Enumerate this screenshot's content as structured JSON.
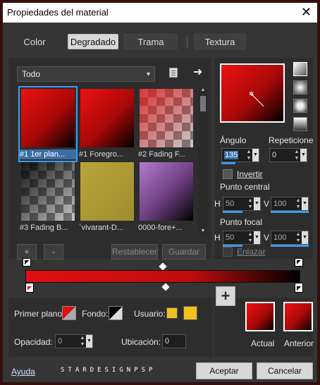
{
  "window": {
    "title": "Propiedades del material",
    "close": "✕"
  },
  "tabs": [
    {
      "label": "Color"
    },
    {
      "label": "Degradado"
    },
    {
      "label": "Trama"
    },
    {
      "label": "Textura"
    }
  ],
  "gallery": {
    "category": "Todo",
    "items": [
      {
        "caption": "#1 1er plan..."
      },
      {
        "caption": "#1 Foregro..."
      },
      {
        "caption": "#2 Fading F..."
      },
      {
        "caption": "#3 Fading B..."
      },
      {
        "caption": "`vivarant-D..."
      },
      {
        "caption": "0000-fore+..."
      }
    ],
    "add_label": "+",
    "remove_label": "-",
    "reset_label": "Restablecer",
    "save_label": "Guardar"
  },
  "gradient_settings": {
    "angle_label": "Ángulo",
    "angle_value": "135",
    "repeat_label": "Repeticione",
    "repeat_value": "0",
    "invert_label": "Invertir",
    "center_label": "Punto central",
    "center_h_label": "H",
    "center_h": "50",
    "center_v_label": "V",
    "center_v": "100",
    "focal_label": "Punto focal",
    "focal_h_label": "H",
    "focal_h": "50",
    "focal_v_label": "V",
    "focal_v": "100",
    "link_label": "Enlazar"
  },
  "bottom": {
    "foreground_label": "Primer plano:",
    "background_label": "Fondo:",
    "user_label": "Usuario:",
    "opacity_label": "Opacidad:",
    "opacity_value": "0",
    "location_label": "Ubicación:",
    "location_value": "0",
    "add_label": "+",
    "current_label": "Actual",
    "previous_label": "Anterior"
  },
  "footer": {
    "help_label": "Ayuda",
    "watermark": "STARDESIGNPSP",
    "ok_label": "Aceptar",
    "cancel_label": "Cancelar"
  },
  "colors": {
    "gradient_start": "#e01010",
    "gradient_end": "#000000",
    "user_swatch": "#f0c020",
    "selection": "#3a9bf0"
  }
}
